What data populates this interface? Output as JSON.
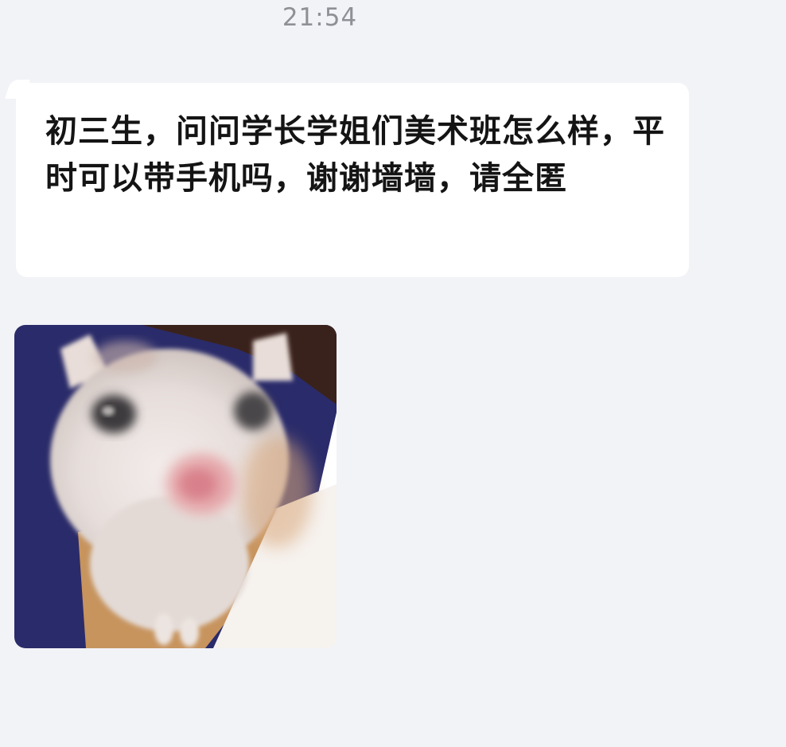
{
  "header": {
    "time": "21:54"
  },
  "message": {
    "text": "初三生，问问学长学姐们美术班怎么样，平时可以带手机吗，谢谢墙墙，请全匿"
  },
  "sticker": {
    "icon": "cat-meme-sticker"
  }
}
